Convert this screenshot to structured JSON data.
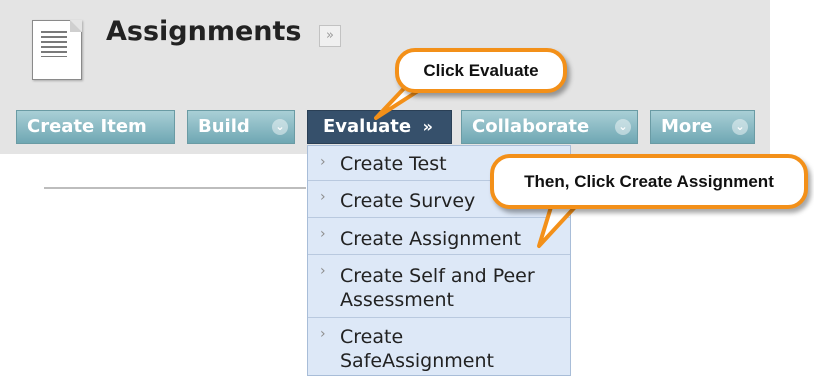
{
  "page": {
    "title": "Assignments"
  },
  "actions": {
    "create_item": "Create Item",
    "build": "Build",
    "evaluate": "Evaluate",
    "collaborate": "Collaborate",
    "more": "More"
  },
  "evaluate_menu": {
    "items": [
      {
        "label": "Create Test"
      },
      {
        "label": "Create Survey"
      },
      {
        "label": "Create Assignment"
      },
      {
        "label_lines": [
          "Create Self and Peer",
          "Assessment"
        ]
      },
      {
        "label_lines": [
          "Create",
          "SafeAssignment"
        ]
      }
    ]
  },
  "callouts": {
    "evaluate": "Click Evaluate",
    "assignment": "Then, Click Create Assignment"
  },
  "icons": {
    "page": "document-icon",
    "title_menu": "double-chevron-down-icon",
    "button_chevron": "chevron-down-icon",
    "menu_item": "chevron-right-icon"
  },
  "colors": {
    "header_band": "#e4e4e4",
    "button_teal": "#7fb5bf",
    "evaluate_active": "#36506b",
    "menu_bg": "#dde8f7",
    "callout_border": "#f39019"
  }
}
